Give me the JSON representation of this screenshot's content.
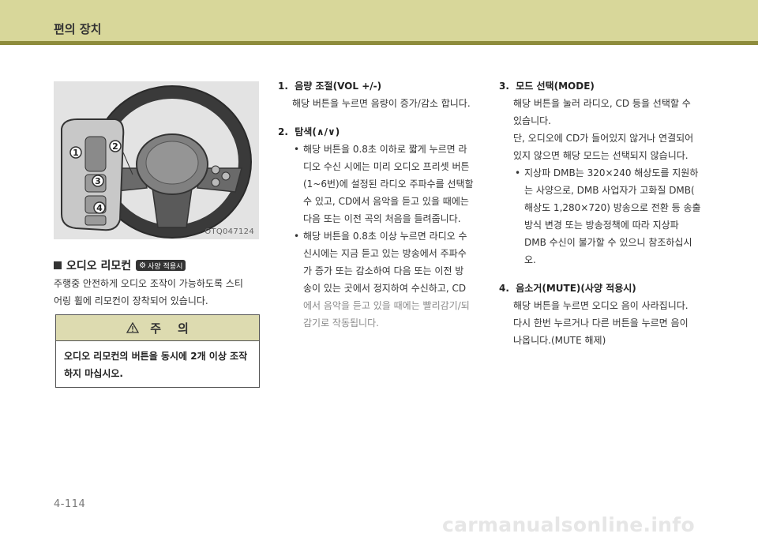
{
  "header": {
    "title": "편의 장치"
  },
  "figure": {
    "code": "OTQ047124",
    "callouts": [
      "1",
      "2",
      "3",
      "4"
    ]
  },
  "section": {
    "heading": "오디오 리모컨",
    "badge_label": "사양 적용시",
    "body_lines": [
      "주행중 안전하게 오디오 조작이 가능하도록 스티",
      "어링 휠에 리모컨이 장착되어 있습니다."
    ]
  },
  "caution": {
    "title": "주    의",
    "lines": [
      "오디오 리모컨의 버튼을 동시에 2개 이상 조작",
      "하지 마십시오."
    ]
  },
  "column2": {
    "item1": {
      "title": "1.  음량 조절(VOL +/-)",
      "line1": "해당 버튼을 누르면 음량이 증가/감소 합니다."
    },
    "item2": {
      "title": "2.  탐색(∧/∨)",
      "bullet1": [
        "해당 버튼을 0.8초 이하로 짧게 누르면 라",
        "디오 수신 시에는 미리 오디오 프리셋 버튼",
        "(1~6번)에 설정된 라디오 주파수를 선택할",
        "수 있고, CD에서 음악을 듣고 있을 때에는",
        "다음 또는 이전 곡의 처음을 들려줍니다."
      ],
      "bullet2": [
        "해당 버튼을 0.8초 이상 누르면 라디오 수",
        "신시에는 지금 듣고 있는 방송에서 주파수",
        "가 증가 또는 감소하여 다음 또는 이전 방",
        "송이 있는 곳에서 정지하여 수신하고, CD"
      ],
      "bullet2_gray": [
        "에서 음악을 듣고 있을 때에는 빨리감기/되",
        "감기로 작동됩니다."
      ]
    }
  },
  "column3": {
    "item3": {
      "title": "3.  모드 선택(MODE)",
      "lines": [
        "해당 버튼을 눌러 라디오, CD 등을 선택할 수",
        "있습니다.",
        "단, 오디오에 CD가 들어있지 않거나 연결되어",
        "있지 않으면 해당 모드는 선택되지 않습니다."
      ],
      "bullet": [
        "지상파 DMB는 320×240 해상도를 지원하",
        "는 사양으로, DMB 사업자가 고화질 DMB(",
        "해상도 1,280×720) 방송으로 전환 등 송출",
        "방식 변경 또는 방송정책에 따라 지상파",
        "DMB 수신이 불가할 수 있으니 참조하십시",
        "오."
      ]
    },
    "item4": {
      "title": "4.  음소거(MUTE)(사양 적용시)",
      "lines": [
        "해당 버튼을 누르면 오디오 음이 사라집니다.",
        "다시 한번 누르거나 다른 버튼을 누르면 음이",
        "나옵니다.(MUTE 해제)"
      ]
    }
  },
  "footer": {
    "page_number": "4-114",
    "watermark": "carmanualsonline.info"
  },
  "colors": {
    "header_band": "#d8d79a",
    "header_rule": "#8e8c3c",
    "caution_head": "#dddbb0"
  },
  "icons": {
    "badge": "gear-icon",
    "caution": "warning-triangle-icon"
  }
}
